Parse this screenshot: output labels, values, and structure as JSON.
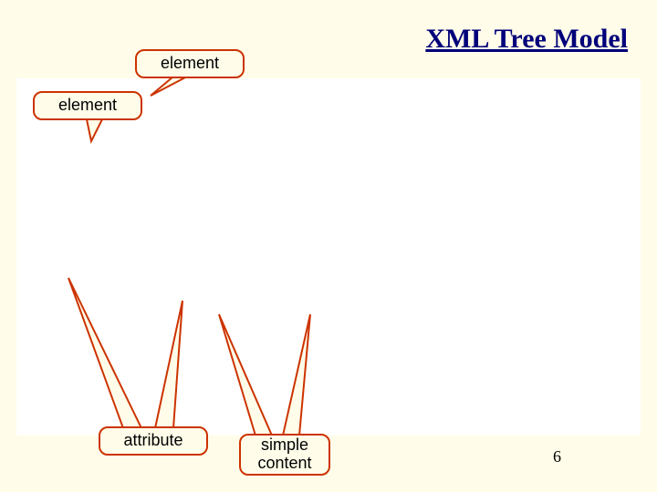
{
  "title": "XML Tree Model",
  "callouts": {
    "element_top": "element",
    "element_left": "element",
    "attribute": "attribute",
    "simple_content": "simple\ncontent"
  },
  "page_number": "6",
  "colors": {
    "bg": "#fffde9",
    "border": "#cc3300",
    "title": "#00007a"
  }
}
